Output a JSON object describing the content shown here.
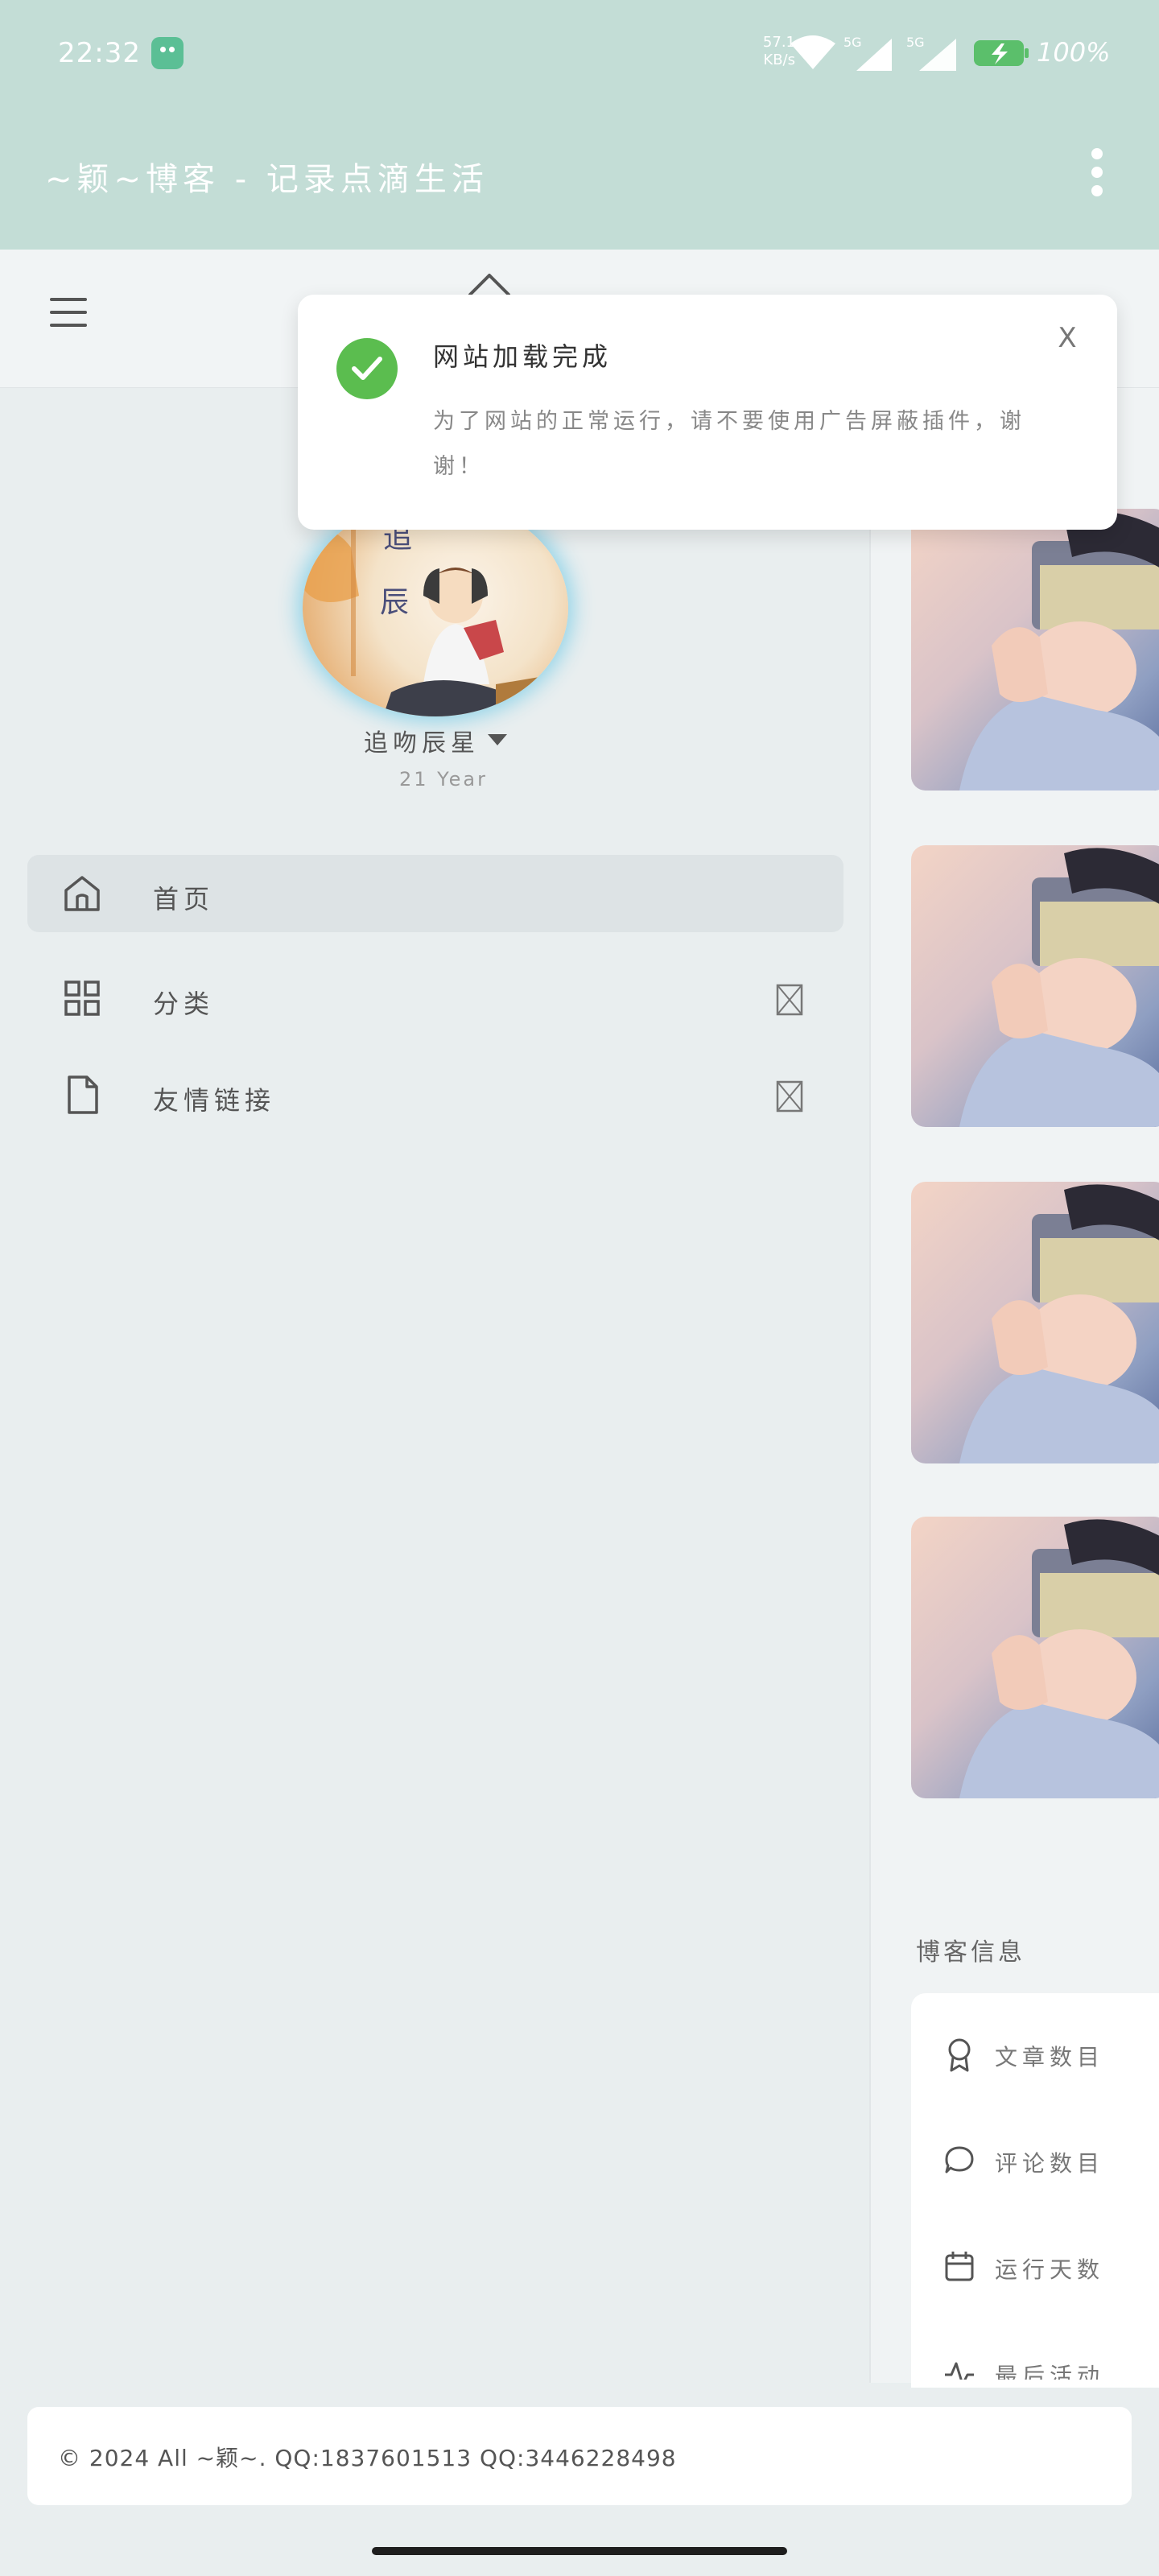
{
  "status_bar": {
    "time": "22:32",
    "net_speed_value": "57.1",
    "net_speed_unit": "KB/s",
    "signal_1_label": "5G",
    "signal_2_label": "5G",
    "battery": "100%"
  },
  "app_bar": {
    "title": "~颖~博客 - 记录点滴生活"
  },
  "toast": {
    "title": "网站加载完成",
    "message": "为了网站的正常运行，请不要使用广告屏蔽插件，谢谢！",
    "close_label": "X",
    "accent": "#5bbd4f"
  },
  "profile": {
    "name": "追吻辰星",
    "years": "21 Year"
  },
  "nav": {
    "items": [
      {
        "label": "首页",
        "icon": "home-icon",
        "active": true
      },
      {
        "label": "分类",
        "icon": "grid-icon",
        "active": false
      },
      {
        "label": "友情链接",
        "icon": "file-icon",
        "active": false
      }
    ]
  },
  "sidebar": {
    "blog_info_title": "博客信息",
    "items": [
      {
        "label": "文章数目",
        "icon": "award-icon"
      },
      {
        "label": "评论数目",
        "icon": "comment-icon"
      },
      {
        "label": "运行天数",
        "icon": "calendar-icon"
      },
      {
        "label": "最后活动",
        "icon": "activity-icon"
      }
    ]
  },
  "footer": {
    "text": "© 2024 All ~颖~. QQ:1837601513 QQ:3446228498"
  },
  "colors": {
    "app_bar": "#c3ddd6",
    "background": "#e9eeef",
    "active_nav": "#dde3e5"
  }
}
